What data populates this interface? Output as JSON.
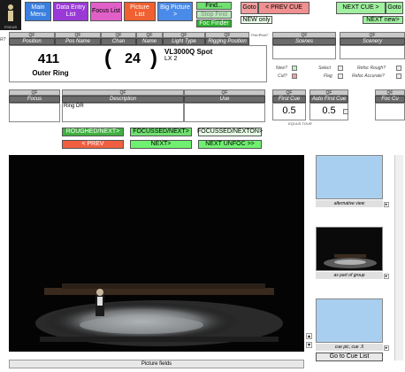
{
  "logo_text": "FOCUS",
  "nav": {
    "main_menu": "Main Menu",
    "data_entry": "Data Entry List",
    "focus_list": "Focus List",
    "picture_list": "Picture List",
    "big_picture": "Big Picture >",
    "find": "Find...",
    "stop_find": "Stop Find",
    "foc_finder": "Foc Finder",
    "goto_prev": "Goto",
    "prev_cue": "< PREV CUE",
    "next_cue": "NEXT CUE >",
    "goto_next": "Goto",
    "new_only": "NEW only",
    "next_new": "NEXT new>"
  },
  "rt_label": "RT",
  "qf": "QF",
  "position": {
    "label": "Position",
    "value": "411",
    "name": "Outer Ring"
  },
  "pos_name": {
    "label": "Pos Name"
  },
  "chan": {
    "label": "Chan",
    "value": "24"
  },
  "name": {
    "label": "Name"
  },
  "light_type": {
    "label": "Light Type",
    "value": "VL3000Q Spot",
    "sub": "LX 2"
  },
  "rigging_position": {
    "label": "Rigging Position"
  },
  "prev_lbl": "Prev?",
  "pool_lbl": "Pool?",
  "scenes": {
    "label": "Scenes"
  },
  "scenery": {
    "label": "Scenery"
  },
  "flags": {
    "new": "New?",
    "cut": "Cut?",
    "select": "Select",
    "flag": "Flag",
    "refoc_rough": "Refoc Rough?",
    "refoc_accurate": "Refoc Accurate?"
  },
  "focus": {
    "label": "Focus"
  },
  "description": {
    "label": "Description",
    "value": "Ring DR"
  },
  "use": {
    "label": "Use"
  },
  "first_cue": {
    "label": "First Cue",
    "value": "0.5"
  },
  "auto_first_cue": {
    "label": "Auto First Cue",
    "value": "0.5"
  },
  "equus_tour": "EQUUS TOUR",
  "foc_cue": {
    "label": "Foc Cu"
  },
  "actions": {
    "roughed_next": "ROUGHED/NEXT>",
    "focussed_next": "FOCUSSED/NEXT>",
    "focussed_nexton": "FOCUSSED/NEXTON>",
    "prev": "< PREV",
    "next": "NEXT>",
    "next_unfoc": "NEXT UNFOC >>"
  },
  "thumbs": {
    "alt_view": "alternative view",
    "part_of_group": "as part of group",
    "cue_pic": "cue pic, cue .5",
    "goto_cue_list": "Go to Cue List"
  },
  "picture_fields": "Picture fields"
}
